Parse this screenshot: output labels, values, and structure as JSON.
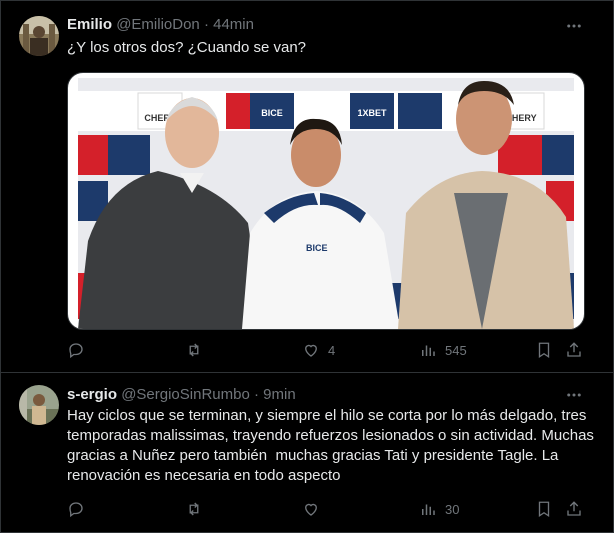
{
  "tweets": [
    {
      "author_name": "Emilio",
      "author_handle": "@EmilioDon",
      "separator": "·",
      "time": "44min",
      "text": "¿Y los otros dos? ¿Cuando se van?",
      "media_description": "Three men posing in front of a sponsor backdrop",
      "stats": {
        "replies": "",
        "retweets": "",
        "likes": "4",
        "views": "545"
      }
    },
    {
      "author_name": "s-ergio",
      "author_handle": "@SergioSinRumbo",
      "separator": "·",
      "time": "9min",
      "text": "Hay ciclos que se terminan, y siempre el hilo se corta por lo más delgado, tres temporadas malissimas, trayendo refuerzos lesionados o sin actividad. Muchas gracias a Nuñez pero también  muchas gracias Tati y presidente Tagle. La renovación es necesaria en todo aspecto",
      "stats": {
        "replies": "",
        "retweets": "",
        "likes": "",
        "views": "30"
      }
    }
  ],
  "backdrop_sponsors": [
    "CHERY",
    "1XBET",
    "BICE"
  ],
  "colors": {
    "background": "#000000",
    "text": "#e7e9ea",
    "muted": "#71767b",
    "border": "#2f3336",
    "sponsor_red": "#d4202a",
    "sponsor_navy": "#1d3a6b"
  },
  "icons": [
    "more-icon",
    "reply-icon",
    "retweet-icon",
    "like-icon",
    "views-icon",
    "bookmark-icon",
    "share-icon"
  ]
}
